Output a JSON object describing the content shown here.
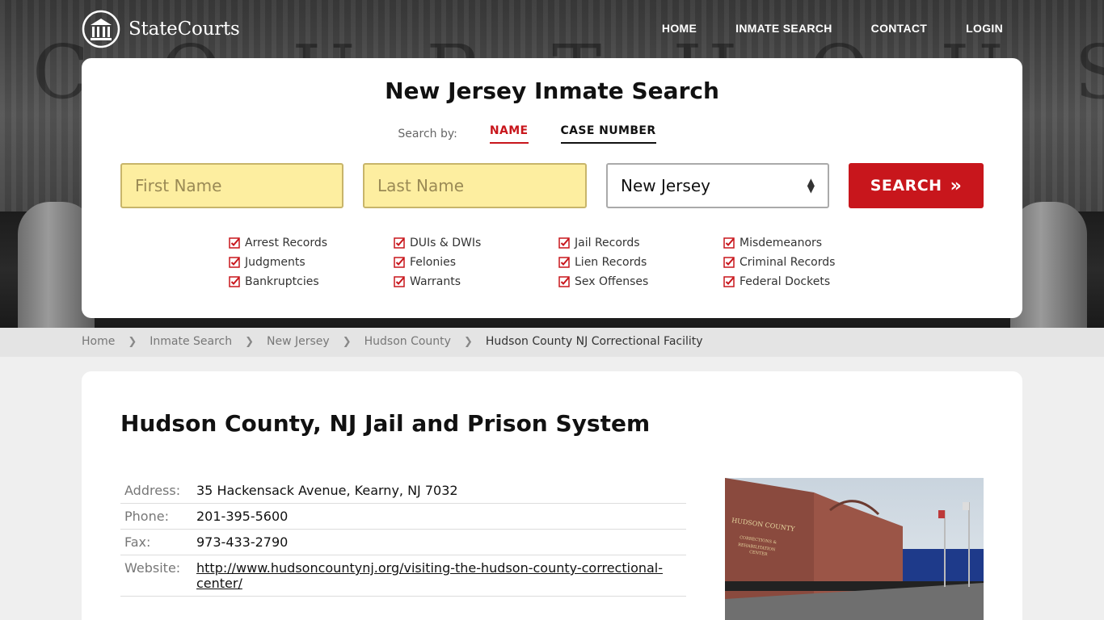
{
  "header": {
    "logo_text": "StateCourts",
    "nav": [
      "HOME",
      "INMATE SEARCH",
      "CONTACT",
      "LOGIN"
    ],
    "hero_letters": "COURTHOUSE"
  },
  "search": {
    "title": "New Jersey Inmate Search",
    "search_by_label": "Search by:",
    "tab_name": "NAME",
    "tab_case": "CASE NUMBER",
    "first_placeholder": "First Name",
    "last_placeholder": "Last Name",
    "state_value": "New Jersey",
    "button_label": "SEARCH",
    "checks": [
      "Arrest Records",
      "DUIs & DWIs",
      "Jail Records",
      "Misdemeanors",
      "Judgments",
      "Felonies",
      "Lien Records",
      "Criminal Records",
      "Bankruptcies",
      "Warrants",
      "Sex Offenses",
      "Federal Dockets"
    ]
  },
  "breadcrumb": [
    "Home",
    "Inmate Search",
    "New Jersey",
    "Hudson County",
    "Hudson County NJ Correctional Facility"
  ],
  "facility": {
    "title": "Hudson County, NJ Jail and Prison System",
    "address_label": "Address:",
    "address": "35 Hackensack Avenue, Kearny, NJ 7032",
    "phone_label": "Phone:",
    "phone": "201-395-5600",
    "fax_label": "Fax:",
    "fax": "973-433-2790",
    "website_label": "Website:",
    "website": "http://www.hudsoncountynj.org/visiting-the-hudson-county-correctional-center/",
    "photo_sign": "HUDSON COUNTY CORRECTIONS & REHABILITATION CENTER"
  },
  "colors": {
    "accent": "#c8161c",
    "field_bg": "#fdeea0"
  }
}
